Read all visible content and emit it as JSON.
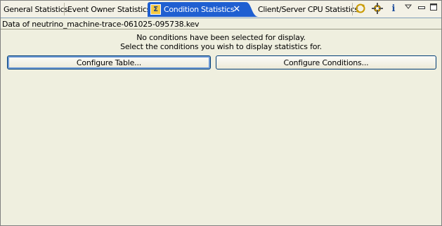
{
  "tabs": [
    {
      "label": "General Statistics",
      "active": false
    },
    {
      "label": "Event Owner Statistics",
      "active": false
    },
    {
      "label": "Condition Statistics",
      "active": true
    },
    {
      "label": "Client/Server CPU Statistics",
      "active": false
    }
  ],
  "active_tab_close": "✕",
  "active_tab_icon": "Σ",
  "data_file_label": "Data of neutrino_machine-trace-061025-095738.kev",
  "message": {
    "line1": "No conditions have been selected for display.",
    "line2": "Select the conditions you wish to display statistics for."
  },
  "buttons": {
    "configure_table": "Configure Table...",
    "configure_conditions": "Configure Conditions..."
  },
  "toolbar_icons": [
    "sync-icon",
    "settings-icon",
    "info-icon",
    "view-menu-icon",
    "minimize-icon",
    "maximize-icon"
  ],
  "colors": {
    "active_tab_bg": "#1f5fd1",
    "panel_bg": "#efefdf"
  }
}
